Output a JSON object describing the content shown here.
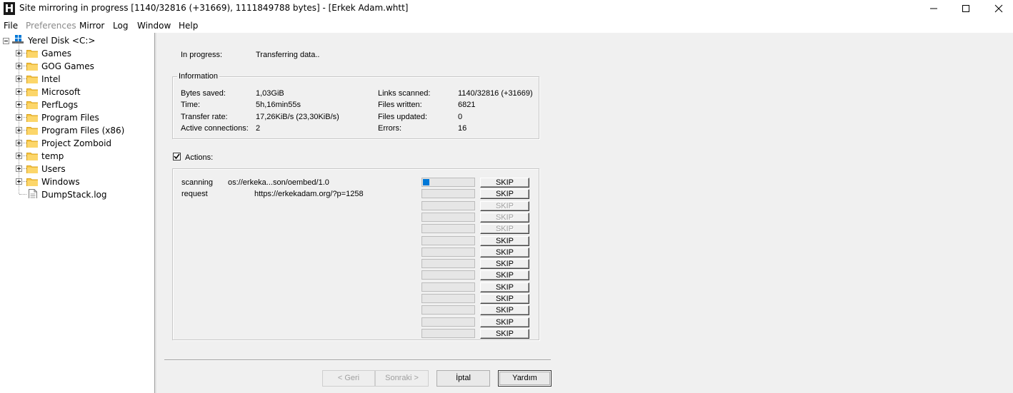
{
  "window": {
    "app_icon_letter": "H",
    "title": "Site mirroring in progress [1140/32816 (+31669), 1111849788 bytes] - [Erkek Adam.whtt]"
  },
  "menu": {
    "items": [
      {
        "label": "File",
        "enabled": true
      },
      {
        "label": "Preferences",
        "enabled": false
      },
      {
        "label": "Mirror",
        "enabled": true
      },
      {
        "label": "Log",
        "enabled": true
      },
      {
        "label": "Window",
        "enabled": true
      },
      {
        "label": "Help",
        "enabled": true
      }
    ]
  },
  "tree": {
    "root": {
      "label": "Yerel Disk <C:>",
      "icon": "drive-icon"
    },
    "children": [
      {
        "label": "Games",
        "type": "folder"
      },
      {
        "label": "GOG Games",
        "type": "folder"
      },
      {
        "label": "Intel",
        "type": "folder"
      },
      {
        "label": "Microsoft",
        "type": "folder"
      },
      {
        "label": "PerfLogs",
        "type": "folder"
      },
      {
        "label": "Program Files",
        "type": "folder"
      },
      {
        "label": "Program Files (x86)",
        "type": "folder"
      },
      {
        "label": "Project Zomboid",
        "type": "folder"
      },
      {
        "label": "temp",
        "type": "folder"
      },
      {
        "label": "Users",
        "type": "folder"
      },
      {
        "label": "Windows",
        "type": "folder"
      },
      {
        "label": "DumpStack.log",
        "type": "file"
      }
    ]
  },
  "status": {
    "in_progress_label": "In progress:",
    "in_progress_value": "Transferring data.."
  },
  "information": {
    "title": "Information",
    "left": [
      {
        "label": "Bytes saved:",
        "value": "1,03GiB"
      },
      {
        "label": "Time:",
        "value": "5h,16min55s"
      },
      {
        "label": "Transfer rate:",
        "value": "17,26KiB/s (23,30KiB/s)"
      },
      {
        "label": "Active connections:",
        "value": "2"
      }
    ],
    "right": [
      {
        "label": "Links scanned:",
        "value": "1140/32816 (+31669)"
      },
      {
        "label": "Files written:",
        "value": "6821"
      },
      {
        "label": "Files updated:",
        "value": "0"
      },
      {
        "label": "Errors:",
        "value": "16"
      }
    ]
  },
  "actions": {
    "checkbox_label": "Actions:",
    "checked": true,
    "skip_label": "SKIP",
    "rows": [
      {
        "action": "scanning",
        "url": "os://erkeka...son/oembed/1.0",
        "progress": 0.12,
        "skip_enabled": true
      },
      {
        "action": "request",
        "url": "https://erkekadam.org/?p=1258",
        "progress": 0,
        "skip_enabled": true
      },
      {
        "action": "",
        "url": "",
        "progress": 0,
        "skip_enabled": false
      },
      {
        "action": "",
        "url": "",
        "progress": 0,
        "skip_enabled": false
      },
      {
        "action": "",
        "url": "",
        "progress": 0,
        "skip_enabled": false
      },
      {
        "action": "",
        "url": "",
        "progress": 0,
        "skip_enabled": true
      },
      {
        "action": "",
        "url": "",
        "progress": 0,
        "skip_enabled": true
      },
      {
        "action": "",
        "url": "",
        "progress": 0,
        "skip_enabled": true
      },
      {
        "action": "",
        "url": "",
        "progress": 0,
        "skip_enabled": true
      },
      {
        "action": "",
        "url": "",
        "progress": 0,
        "skip_enabled": true
      },
      {
        "action": "",
        "url": "",
        "progress": 0,
        "skip_enabled": true
      },
      {
        "action": "",
        "url": "",
        "progress": 0,
        "skip_enabled": true
      },
      {
        "action": "",
        "url": "",
        "progress": 0,
        "skip_enabled": true
      },
      {
        "action": "",
        "url": "",
        "progress": 0,
        "skip_enabled": true
      }
    ]
  },
  "wizard_buttons": {
    "back": {
      "label": "< Geri",
      "enabled": false
    },
    "next": {
      "label": "Sonraki >",
      "enabled": false
    },
    "cancel": {
      "label": "İptal",
      "enabled": true
    },
    "help": {
      "label": "Yardım",
      "enabled": true
    }
  }
}
